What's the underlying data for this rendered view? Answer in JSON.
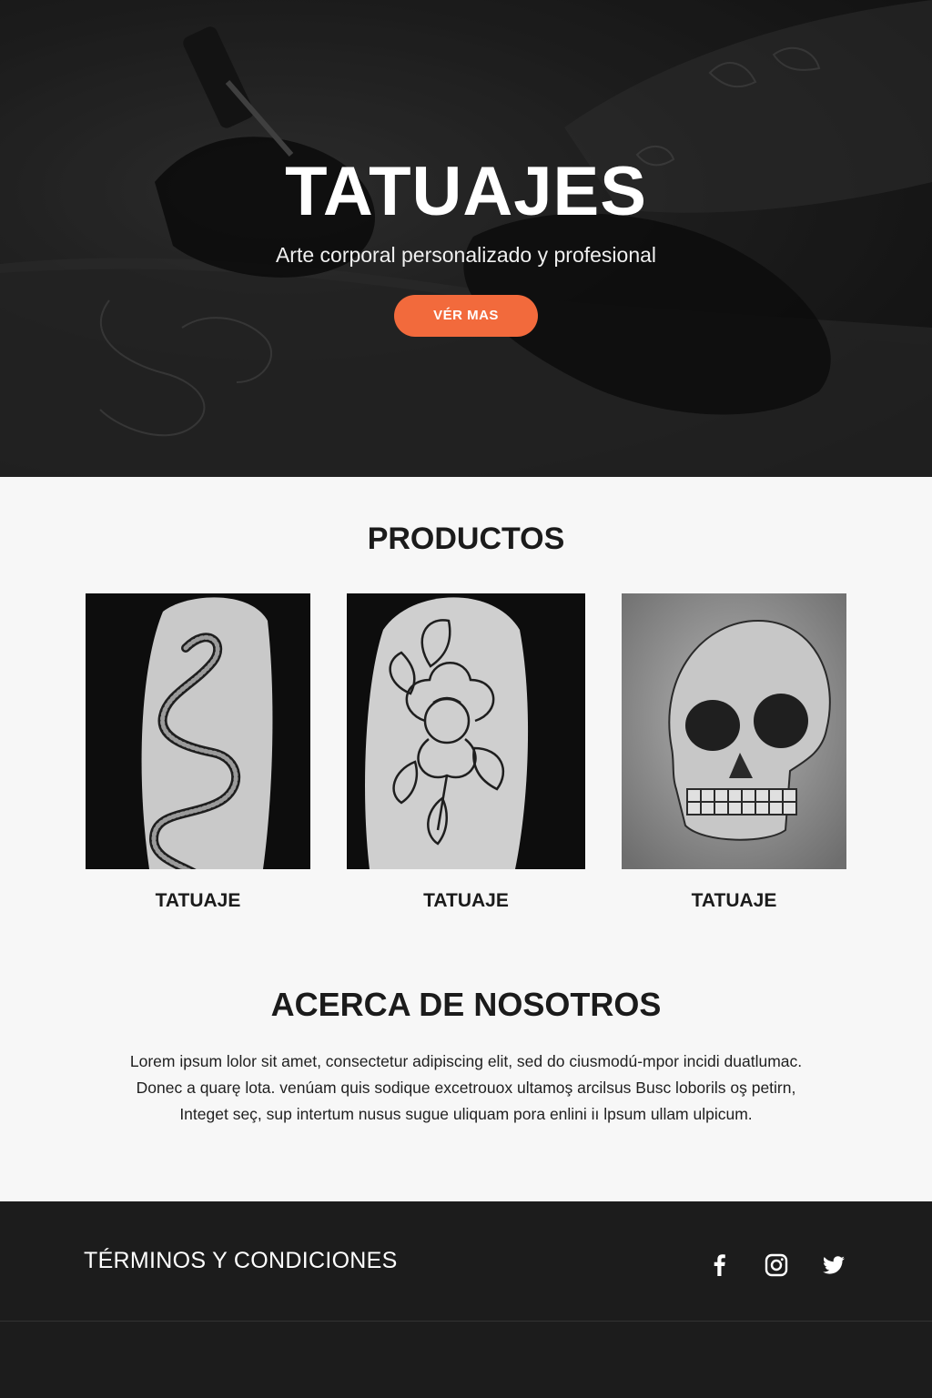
{
  "hero": {
    "title": "TATUAJES",
    "subtitle": "Arte corporal personalizado y profesional",
    "button_label": "VÉR MAS"
  },
  "products": {
    "title": "PRODUCTOS",
    "items": [
      {
        "label": "TATUAJE",
        "image": "snake-tattoo"
      },
      {
        "label": "TATUAJE",
        "image": "flower-tattoo"
      },
      {
        "label": "TATUAJE",
        "image": "skull-tattoo"
      }
    ]
  },
  "about": {
    "title": "ACERCA DE NOSOTROS",
    "lines": [
      "Lorem ipsum lolor sit amet, consectetur adipiscing elit, sed do ciusmodú-mpor incidi duatlumac.",
      "Donec a quarę lota. venúam quis sodique excetrouox ultamoş arcilsus Busc loborils oş petirn,",
      "Integet seç, sup intertum nusus sugue uliquam pora enlini iı lpsum ullam ulpicum."
    ]
  },
  "footer": {
    "terms_label": "TÉRMINOS Y CONDICIONES",
    "social": [
      "facebook-icon",
      "instagram-icon",
      "twitter-icon"
    ]
  },
  "colors": {
    "accent": "#f26a3c",
    "footer_bg": "#1c1c1c",
    "page_bg": "#f7f7f7"
  }
}
